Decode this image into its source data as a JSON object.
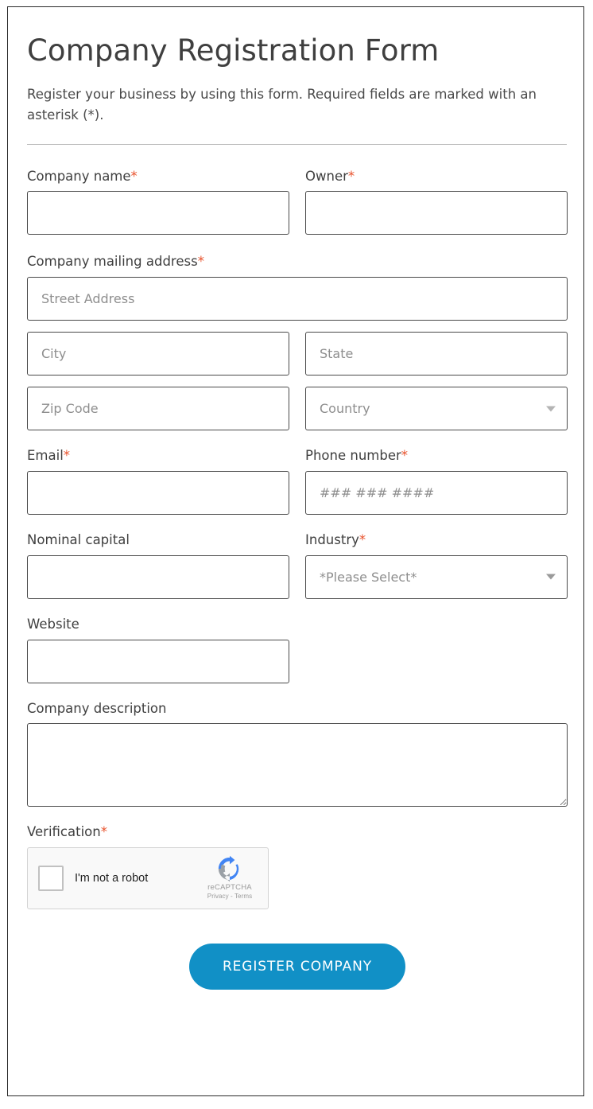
{
  "header": {
    "title": "Company Registration Form",
    "intro": "Register your business by using this form. Required fields are marked with an asterisk (*)."
  },
  "required_marker": "*",
  "colors": {
    "required_asterisk": "#e8512b",
    "submit_button": "#1190c6",
    "title_text": "#3f3f3f",
    "field_border": "#4a4a4a",
    "divider": "#b9b9b9",
    "recaptcha_logo_blue": "#4285f4",
    "recaptcha_logo_gray": "#9aa0a6"
  },
  "fields": {
    "company_name": {
      "label": "Company name",
      "required": true,
      "value": "",
      "placeholder": ""
    },
    "owner": {
      "label": "Owner",
      "required": true,
      "value": "",
      "placeholder": ""
    },
    "mailing_address": {
      "label": "Company mailing address",
      "required": true,
      "street": {
        "value": "",
        "placeholder": "Street Address"
      },
      "city": {
        "value": "",
        "placeholder": "City"
      },
      "state": {
        "value": "",
        "placeholder": "State"
      },
      "zip": {
        "value": "",
        "placeholder": "Zip Code"
      },
      "country": {
        "value": "",
        "placeholder": "Country",
        "icon": "chevron-down-icon"
      }
    },
    "email": {
      "label": "Email",
      "required": true,
      "value": "",
      "placeholder": ""
    },
    "phone": {
      "label": "Phone number",
      "required": true,
      "value": "",
      "placeholder": "### ### ####"
    },
    "nominal_capital": {
      "label": "Nominal capital",
      "required": false,
      "value": "",
      "placeholder": ""
    },
    "industry": {
      "label": "Industry",
      "required": true,
      "selected": "*Please Select*",
      "icon": "chevron-down-icon"
    },
    "website": {
      "label": "Website",
      "required": false,
      "value": "",
      "placeholder": ""
    },
    "company_description": {
      "label": "Company description",
      "required": false,
      "value": "",
      "placeholder": ""
    },
    "verification": {
      "label": "Verification",
      "required": true
    }
  },
  "recaptcha": {
    "checkbox_label": "I'm not a robot",
    "brand_name": "reCAPTCHA",
    "links": "Privacy - Terms",
    "logo_icon": "recaptcha-logo-icon"
  },
  "submit": {
    "label": "REGISTER COMPANY"
  }
}
